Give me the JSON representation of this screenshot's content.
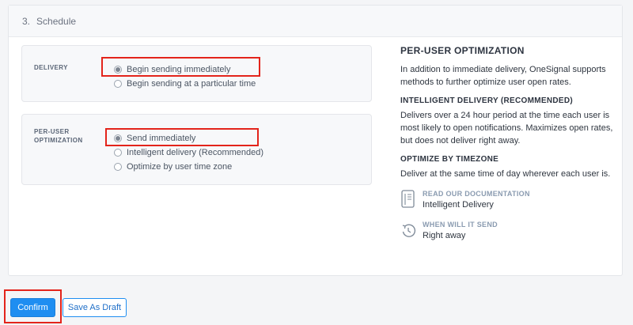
{
  "section": {
    "number": "3.",
    "title": "Schedule"
  },
  "delivery": {
    "label": "DELIVERY",
    "options": [
      {
        "label": "Begin sending immediately",
        "checked": true
      },
      {
        "label": "Begin sending at a particular time",
        "checked": false
      }
    ]
  },
  "per_user": {
    "label_line1": "PER-USER",
    "label_line2": "OPTIMIZATION",
    "options": [
      {
        "label": "Send immediately",
        "checked": true
      },
      {
        "label": "Intelligent delivery (Recommended)",
        "checked": false
      },
      {
        "label": "Optimize by user time zone",
        "checked": false
      }
    ]
  },
  "info": {
    "title": "PER-USER OPTIMIZATION",
    "intro": "In addition to immediate delivery, OneSignal supports methods to further optimize user open rates.",
    "intelligent_title": "INTELLIGENT DELIVERY (RECOMMENDED)",
    "intelligent_text": "Delivers over a 24 hour period at the time each user is most likely to open notifications. Maximizes open rates, but does not deliver right away.",
    "timezone_title": "OPTIMIZE BY TIMEZONE",
    "timezone_text": "Deliver at the same time of day wherever each user is.",
    "docs_title": "READ OUR DOCUMENTATION",
    "docs_link": "Intelligent Delivery",
    "when_title": "WHEN WILL IT SEND",
    "when_value": "Right away"
  },
  "buttons": {
    "confirm": "Confirm",
    "save_draft": "Save As Draft"
  },
  "colors": {
    "primary": "#1f8ef1",
    "highlight": "#e3241b"
  }
}
